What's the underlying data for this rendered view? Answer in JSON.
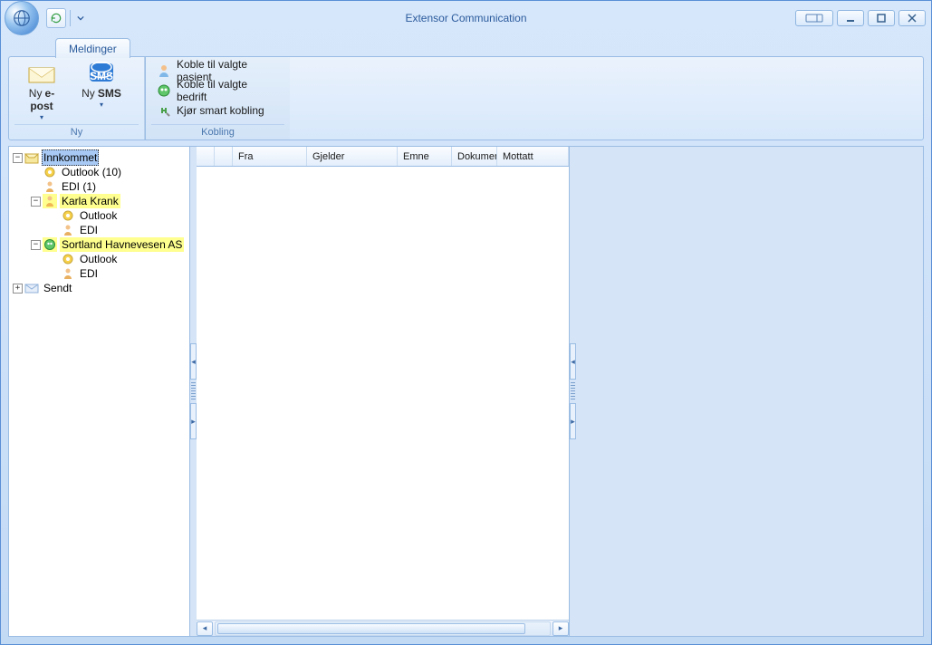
{
  "window": {
    "title": "Extensor Communication"
  },
  "tabs": {
    "meldinger": "Meldinger"
  },
  "ribbon": {
    "ny_group": "Ny",
    "kobling_group": "Kobling",
    "ny_epost_l1": "Ny",
    "ny_epost_l2": "e-post",
    "ny_sms_l1": "Ny",
    "ny_sms_l2": "SMS",
    "koble_pasient": "Koble til valgte pasient",
    "koble_bedrift": "Koble til valgte bedrift",
    "kjor_smart": "Kjør smart kobling"
  },
  "tree": {
    "innkommet": "Innkommet",
    "outlook10": "Outlook  (10)",
    "edi1": "EDI  (1)",
    "karla": "Karla Krank",
    "outlook": "Outlook",
    "edi": "EDI",
    "sortland": "Sortland Havnevesen AS",
    "sendt": "Sendt"
  },
  "grid": {
    "fra": "Fra",
    "gjelder": "Gjelder",
    "emne": "Emne",
    "dokumenter": "Dokumer",
    "mottatt": "Mottatt"
  }
}
